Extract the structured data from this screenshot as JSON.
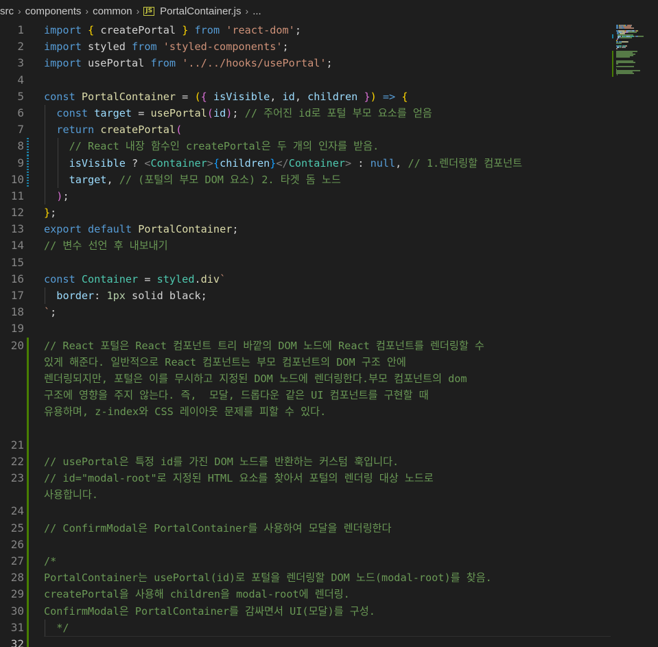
{
  "breadcrumb": {
    "items": [
      "src",
      "components",
      "common"
    ],
    "file_icon": "JS",
    "file": "PortalContainer.js",
    "trailing": "..."
  },
  "editor": {
    "language": "javascript",
    "active_line": 32,
    "lines": [
      {
        "n": "1",
        "diff": null,
        "indent": [],
        "tokens": [
          [
            "k",
            "import"
          ],
          [
            "p",
            " "
          ],
          [
            "b1",
            "{"
          ],
          [
            "p",
            " createPortal "
          ],
          [
            "b1",
            "}"
          ],
          [
            "p",
            " "
          ],
          [
            "k",
            "from"
          ],
          [
            "p",
            " "
          ],
          [
            "s",
            "'react-dom'"
          ],
          [
            "p",
            ";"
          ]
        ]
      },
      {
        "n": "2",
        "diff": null,
        "indent": [],
        "tokens": [
          [
            "k",
            "import"
          ],
          [
            "p",
            " styled "
          ],
          [
            "k",
            "from"
          ],
          [
            "p",
            " "
          ],
          [
            "s",
            "'styled-components'"
          ],
          [
            "p",
            ";"
          ]
        ]
      },
      {
        "n": "3",
        "diff": null,
        "indent": [],
        "tokens": [
          [
            "k",
            "import"
          ],
          [
            "p",
            " usePortal "
          ],
          [
            "k",
            "from"
          ],
          [
            "p",
            " "
          ],
          [
            "s",
            "'../../hooks/usePortal'"
          ],
          [
            "p",
            ";"
          ]
        ]
      },
      {
        "n": "4",
        "diff": null,
        "indent": [],
        "tokens": []
      },
      {
        "n": "5",
        "diff": null,
        "indent": [],
        "tokens": [
          [
            "k",
            "const"
          ],
          [
            "p",
            " "
          ],
          [
            "f",
            "PortalContainer"
          ],
          [
            "p",
            " = "
          ],
          [
            "b1",
            "("
          ],
          [
            "b2",
            "{"
          ],
          [
            "p",
            " "
          ],
          [
            "v",
            "isVisible"
          ],
          [
            "p",
            ", "
          ],
          [
            "v",
            "id"
          ],
          [
            "p",
            ", "
          ],
          [
            "v",
            "children"
          ],
          [
            "p",
            " "
          ],
          [
            "b2",
            "}"
          ],
          [
            "b1",
            ")"
          ],
          [
            "p",
            " "
          ],
          [
            "k",
            "=>"
          ],
          [
            "p",
            " "
          ],
          [
            "b1",
            "{"
          ]
        ]
      },
      {
        "n": "6",
        "diff": null,
        "indent": [
          0
        ],
        "tokens": [
          [
            "p",
            "  "
          ],
          [
            "k",
            "const"
          ],
          [
            "p",
            " "
          ],
          [
            "v",
            "target"
          ],
          [
            "p",
            " = "
          ],
          [
            "f",
            "usePortal"
          ],
          [
            "b2",
            "("
          ],
          [
            "v",
            "id"
          ],
          [
            "b2",
            ")"
          ],
          [
            "p",
            "; "
          ],
          [
            "c",
            "// 주어진 id로 포털 부모 요소를 얻음"
          ]
        ]
      },
      {
        "n": "7",
        "diff": null,
        "indent": [
          0
        ],
        "tokens": [
          [
            "p",
            "  "
          ],
          [
            "k",
            "return"
          ],
          [
            "p",
            " "
          ],
          [
            "f",
            "createPortal"
          ],
          [
            "b2",
            "("
          ]
        ]
      },
      {
        "n": "8",
        "diff": "modified",
        "indent": [
          0,
          1
        ],
        "tokens": [
          [
            "p",
            "    "
          ],
          [
            "c",
            "// React 내장 함수인 createPortal은 두 개의 인자를 받음."
          ]
        ]
      },
      {
        "n": "9",
        "diff": "modified",
        "indent": [
          0,
          1
        ],
        "tokens": [
          [
            "p",
            "    "
          ],
          [
            "v",
            "isVisible"
          ],
          [
            "p",
            " ? "
          ],
          [
            "tg",
            "<"
          ],
          [
            "t",
            "Container"
          ],
          [
            "tg",
            ">"
          ],
          [
            "b3",
            "{"
          ],
          [
            "v",
            "children"
          ],
          [
            "b3",
            "}"
          ],
          [
            "tg",
            "</"
          ],
          [
            "t",
            "Container"
          ],
          [
            "tg",
            ">"
          ],
          [
            "p",
            " : "
          ],
          [
            "k",
            "null"
          ],
          [
            "p",
            ", "
          ],
          [
            "c",
            "// 1.렌더링할 컴포넌트"
          ]
        ]
      },
      {
        "n": "10",
        "diff": "modified",
        "indent": [
          0,
          1
        ],
        "tokens": [
          [
            "p",
            "    "
          ],
          [
            "v",
            "target"
          ],
          [
            "p",
            ", "
          ],
          [
            "c",
            "// (포털의 부모 DOM 요소) 2. 타겟 돔 노드"
          ]
        ]
      },
      {
        "n": "11",
        "diff": null,
        "indent": [
          0
        ],
        "tokens": [
          [
            "p",
            "  "
          ],
          [
            "b2",
            ")"
          ],
          [
            "p",
            ";"
          ]
        ]
      },
      {
        "n": "12",
        "diff": null,
        "indent": [],
        "tokens": [
          [
            "b1",
            "}"
          ],
          [
            "p",
            ";"
          ]
        ]
      },
      {
        "n": "13",
        "diff": null,
        "indent": [],
        "tokens": [
          [
            "k",
            "export"
          ],
          [
            "p",
            " "
          ],
          [
            "k",
            "default"
          ],
          [
            "p",
            " "
          ],
          [
            "f",
            "PortalContainer"
          ],
          [
            "p",
            ";"
          ]
        ]
      },
      {
        "n": "14",
        "diff": null,
        "indent": [],
        "tokens": [
          [
            "c",
            "// 변수 선언 후 내보내기"
          ]
        ]
      },
      {
        "n": "15",
        "diff": null,
        "indent": [],
        "tokens": []
      },
      {
        "n": "16",
        "diff": null,
        "indent": [],
        "tokens": [
          [
            "k",
            "const"
          ],
          [
            "p",
            " "
          ],
          [
            "t",
            "Container"
          ],
          [
            "p",
            " = "
          ],
          [
            "t",
            "styled"
          ],
          [
            "p",
            "."
          ],
          [
            "f",
            "div"
          ],
          [
            "s",
            "`"
          ]
        ]
      },
      {
        "n": "17",
        "diff": null,
        "indent": [
          0
        ],
        "tokens": [
          [
            "p",
            "  "
          ],
          [
            "v",
            "border"
          ],
          [
            "p",
            ": "
          ],
          [
            "num",
            "1px"
          ],
          [
            "p",
            " solid black;"
          ]
        ]
      },
      {
        "n": "18",
        "diff": null,
        "indent": [],
        "tokens": [
          [
            "s",
            "`"
          ],
          [
            "p",
            ";"
          ]
        ]
      },
      {
        "n": "19",
        "diff": null,
        "indent": [],
        "tokens": []
      },
      {
        "n": "20",
        "diff": "added",
        "indent": [],
        "tokens": [
          [
            "c",
            "// React 포털은 React 컴포넌트 트리 바깥의 DOM 노드에 React 컴포넌트를 렌더링할 수"
          ]
        ]
      },
      {
        "n": "",
        "diff": "added",
        "indent": [],
        "tokens": [
          [
            "c",
            "있게 해준다. 일반적으로 React 컴포넌트는 부모 컴포넌트의 DOM 구조 안에"
          ]
        ]
      },
      {
        "n": "",
        "diff": "added",
        "indent": [],
        "tokens": [
          [
            "c",
            "렌더링되지만, 포털은 이를 무시하고 지정된 DOM 노드에 렌더링한다.부모 컴포넌트의 dom"
          ]
        ]
      },
      {
        "n": "",
        "diff": "added",
        "indent": [],
        "tokens": [
          [
            "c",
            "구조에 영향을 주지 않는다. 즉,  모달, 드롭다운 같은 UI 컴포넌트를 구현할 때"
          ]
        ]
      },
      {
        "n": "",
        "diff": "added",
        "indent": [],
        "tokens": [
          [
            "c",
            "유용하며, z-index와 CSS 레이아웃 문제를 피할 수 있다."
          ]
        ]
      },
      {
        "n": "",
        "diff": "added",
        "indent": [],
        "tokens": []
      },
      {
        "n": "21",
        "diff": "added",
        "indent": [],
        "tokens": []
      },
      {
        "n": "22",
        "diff": "added",
        "indent": [],
        "tokens": [
          [
            "c",
            "// usePortal은 특정 id를 가진 DOM 노드를 반환하는 커스텀 훅입니다."
          ]
        ]
      },
      {
        "n": "23",
        "diff": "added",
        "indent": [],
        "tokens": [
          [
            "c",
            "// id=\"modal-root\"로 지정된 HTML 요소를 찾아서 포털의 렌더링 대상 노드로"
          ]
        ]
      },
      {
        "n": "",
        "diff": "added",
        "indent": [],
        "tokens": [
          [
            "c",
            "사용합니다."
          ]
        ]
      },
      {
        "n": "24",
        "diff": "added",
        "indent": [],
        "tokens": []
      },
      {
        "n": "25",
        "diff": "added",
        "indent": [],
        "tokens": [
          [
            "c",
            "// ConfirmModal은 PortalContainer를 사용하여 모달을 렌더링한다"
          ]
        ]
      },
      {
        "n": "26",
        "diff": "added",
        "indent": [],
        "tokens": []
      },
      {
        "n": "27",
        "diff": "added",
        "indent": [],
        "tokens": [
          [
            "c",
            "/*"
          ]
        ]
      },
      {
        "n": "28",
        "diff": "added",
        "indent": [],
        "tokens": [
          [
            "c",
            "PortalContainer는 usePortal(id)로 포털을 렌더링할 DOM 노드(modal-root)를 찾음."
          ]
        ]
      },
      {
        "n": "29",
        "diff": "added",
        "indent": [],
        "tokens": [
          [
            "c",
            "createPortal을 사용해 children을 modal-root에 렌더링."
          ]
        ]
      },
      {
        "n": "30",
        "diff": "added",
        "indent": [],
        "tokens": [
          [
            "c",
            "ConfirmModal은 PortalContainer를 감싸면서 UI(모달)를 구성."
          ]
        ]
      },
      {
        "n": "31",
        "diff": "added",
        "indent": [
          0
        ],
        "tokens": [
          [
            "c",
            "  */"
          ]
        ]
      },
      {
        "n": "32",
        "diff": "added",
        "indent": [],
        "tokens": []
      }
    ]
  },
  "colors": {
    "background": "#1e1e1e",
    "keyword": "#569cd6",
    "function": "#dcdcaa",
    "string": "#ce9178",
    "comment": "#6a9955",
    "variable": "#9cdcfe",
    "type": "#4ec9b0",
    "diff_added": "#487e02",
    "diff_modified": "#1b81a8"
  }
}
